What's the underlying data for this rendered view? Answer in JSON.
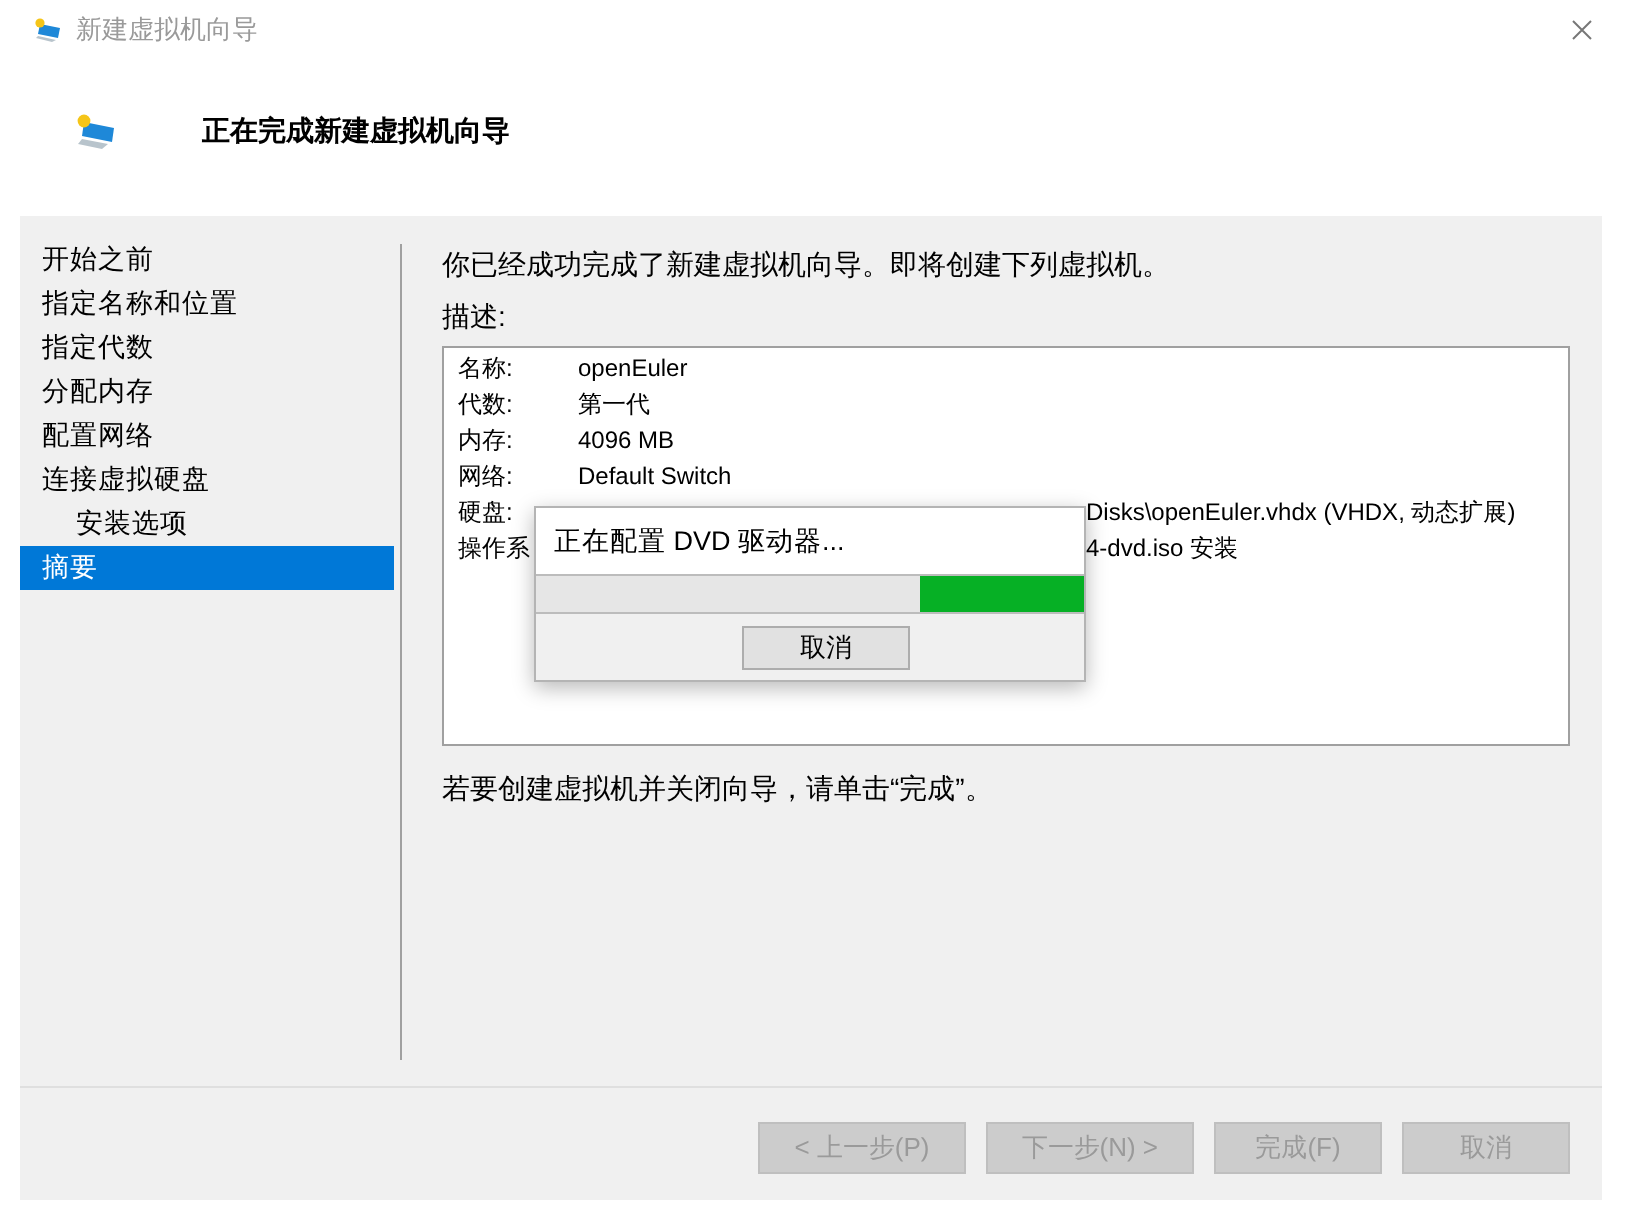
{
  "window": {
    "title": "新建虚拟机向导"
  },
  "header": {
    "title": "正在完成新建虚拟机向导"
  },
  "sidebar": {
    "items": [
      {
        "label": "开始之前",
        "selected": false
      },
      {
        "label": "指定名称和位置",
        "selected": false
      },
      {
        "label": "指定代数",
        "selected": false
      },
      {
        "label": "分配内存",
        "selected": false
      },
      {
        "label": "配置网络",
        "selected": false
      },
      {
        "label": "连接虚拟硬盘",
        "selected": false,
        "children": [
          {
            "label": "安装选项",
            "selected": false
          }
        ]
      },
      {
        "label": "摘要",
        "selected": true
      }
    ]
  },
  "content": {
    "intro": "你已经成功完成了新建虚拟机向导。即将创建下列虚拟机。",
    "description_label": "描述:",
    "summary_rows": [
      {
        "kind": "full",
        "label": "名称:",
        "value": "openEuler"
      },
      {
        "kind": "full",
        "label": "代数:",
        "value": "第一代"
      },
      {
        "kind": "full",
        "label": "内存:",
        "value": "4096 MB"
      },
      {
        "kind": "full",
        "label": "网络:",
        "value": "Default Switch"
      },
      {
        "kind": "covered",
        "label": "硬盘:",
        "value": "Disks\\openEuler.vhdx (VHDX, 动态扩展)"
      },
      {
        "kind": "covered",
        "label": "操作系",
        "value": "4-dvd.iso 安装"
      }
    ],
    "finish_hint": "若要创建虚拟机并关闭向导，请单击“完成”。"
  },
  "progress_dialog": {
    "message": "正在配置 DVD 驱动器...",
    "progress": {
      "level": 0.3
    },
    "cancel_button": {
      "label": "取消"
    }
  },
  "buttons": [
    {
      "label": "< 上一步(P)",
      "disabled": true
    },
    {
      "label": "下一步(N) >",
      "disabled": true
    },
    {
      "label": "完成(F)",
      "disabled": true
    },
    {
      "label": "取消",
      "disabled": true
    }
  ]
}
